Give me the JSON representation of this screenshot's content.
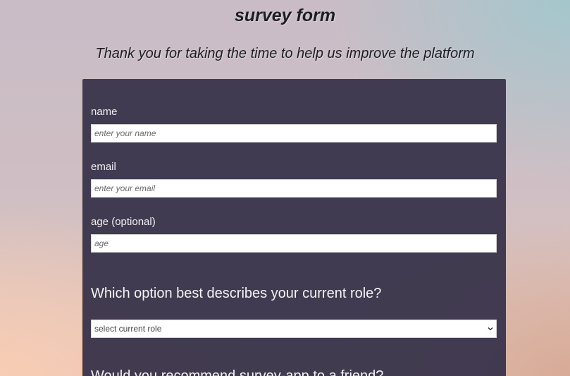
{
  "header": {
    "title": "survey form",
    "subtitle": "Thank you for taking the time to help us improve the platform"
  },
  "form": {
    "name_label": "name",
    "name_placeholder": "enter your name",
    "email_label": "email",
    "email_placeholder": "enter your email",
    "age_label": "age (optional)",
    "age_placeholder": "age",
    "role_question": "Which option best describes your current role?",
    "role_select_value": "select current role",
    "recommend_question": "Would you recommend survey-app to a friend?"
  },
  "colors": {
    "card_background": "#3a354c",
    "title_text": "#1d1d24",
    "label_text": "#f2f2f2"
  },
  "icons": {
    "select_arrow": "chevron-down-icon"
  }
}
